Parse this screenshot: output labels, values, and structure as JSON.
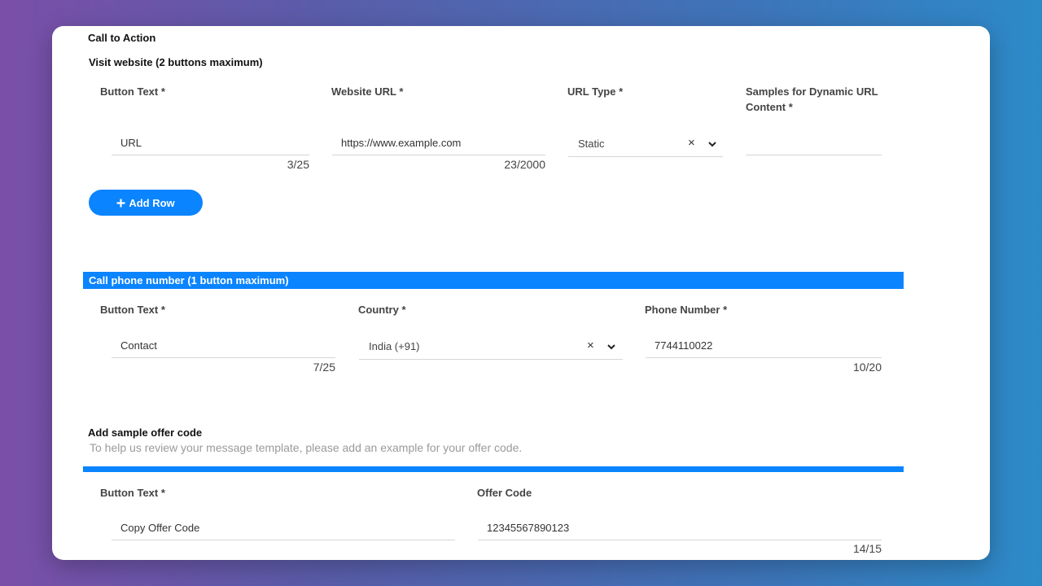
{
  "call_to_action": {
    "title": "Call to Action"
  },
  "visit_website": {
    "title": "Visit website (2 buttons maximum)",
    "labels": {
      "button_text": "Button Text *",
      "website_url": "Website URL *",
      "url_type": "URL Type *",
      "samples": "Samples for Dynamic URL Content *"
    },
    "button_text_value": "URL",
    "button_text_counter": "3/25",
    "website_url_value": "https://www.example.com",
    "website_url_counter": "23/2000",
    "url_type_value": "Static",
    "samples_value": "",
    "add_row_label": "Add Row"
  },
  "call_phone": {
    "title": "Call phone number (1 button maximum)",
    "labels": {
      "button_text": "Button Text *",
      "country": "Country *",
      "phone_number": "Phone Number *"
    },
    "button_text_value": "Contact",
    "button_text_counter": "7/25",
    "country_value": "India (+91)",
    "phone_value": "7744110022",
    "phone_counter": "10/20"
  },
  "offer_code": {
    "title": "Add sample offer code",
    "hint": "To help us review your message template, please add an example for your offer code.",
    "labels": {
      "button_text": "Button Text *",
      "offer_code": "Offer Code"
    },
    "button_text_value": "Copy Offer Code",
    "offer_code_value": "12345567890123",
    "offer_code_counter": "14/15"
  },
  "colors": {
    "accent": "#0a84ff"
  },
  "icons": {
    "clear": "close-icon",
    "dropdown": "chevron-down-icon",
    "add": "plus-icon"
  }
}
